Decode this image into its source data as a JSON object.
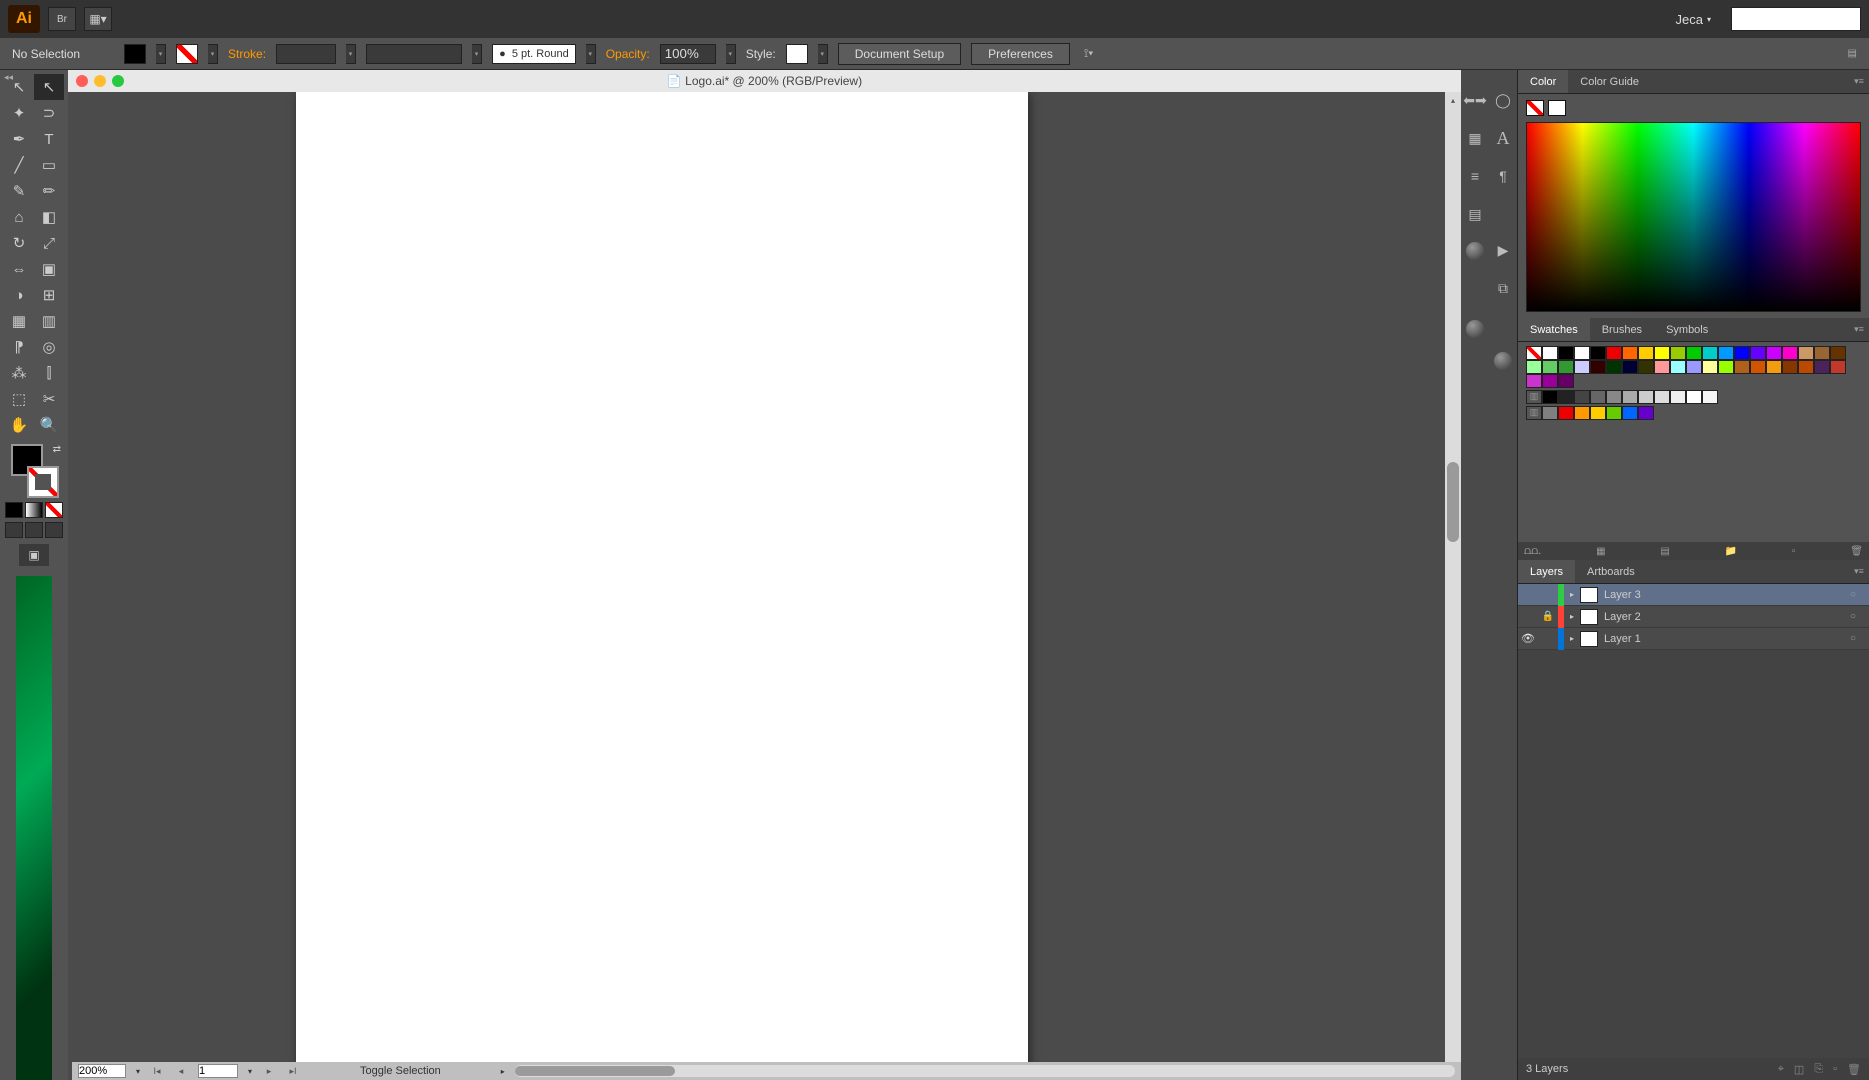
{
  "topbar": {
    "user": "Jeca"
  },
  "controlbar": {
    "selection_status": "No Selection",
    "stroke_label": "Stroke:",
    "profile_label": "5 pt. Round",
    "opacity_label": "Opacity:",
    "opacity_value": "100%",
    "style_label": "Style:",
    "doc_setup": "Document Setup",
    "preferences": "Preferences"
  },
  "document": {
    "title": "Logo.ai* @ 200% (RGB/Preview)"
  },
  "panels": {
    "color": {
      "tab": "Color",
      "guide_tab": "Color Guide"
    },
    "swatches": {
      "tab": "Swatches",
      "brushes_tab": "Brushes",
      "symbols_tab": "Symbols"
    },
    "layers": {
      "tab": "Layers",
      "artboards_tab": "Artboards",
      "rows": [
        {
          "name": "Layer 3",
          "color": "#2ecc40",
          "selected": true,
          "visible": false,
          "locked": false
        },
        {
          "name": "Layer 2",
          "color": "#ff4136",
          "selected": false,
          "visible": false,
          "locked": true
        },
        {
          "name": "Layer 1",
          "color": "#0074d9",
          "selected": false,
          "visible": true,
          "locked": false
        }
      ],
      "footer": "3 Layers"
    }
  },
  "statusbar": {
    "zoom": "200%",
    "artboard": "1",
    "hint": "Toggle Selection"
  }
}
